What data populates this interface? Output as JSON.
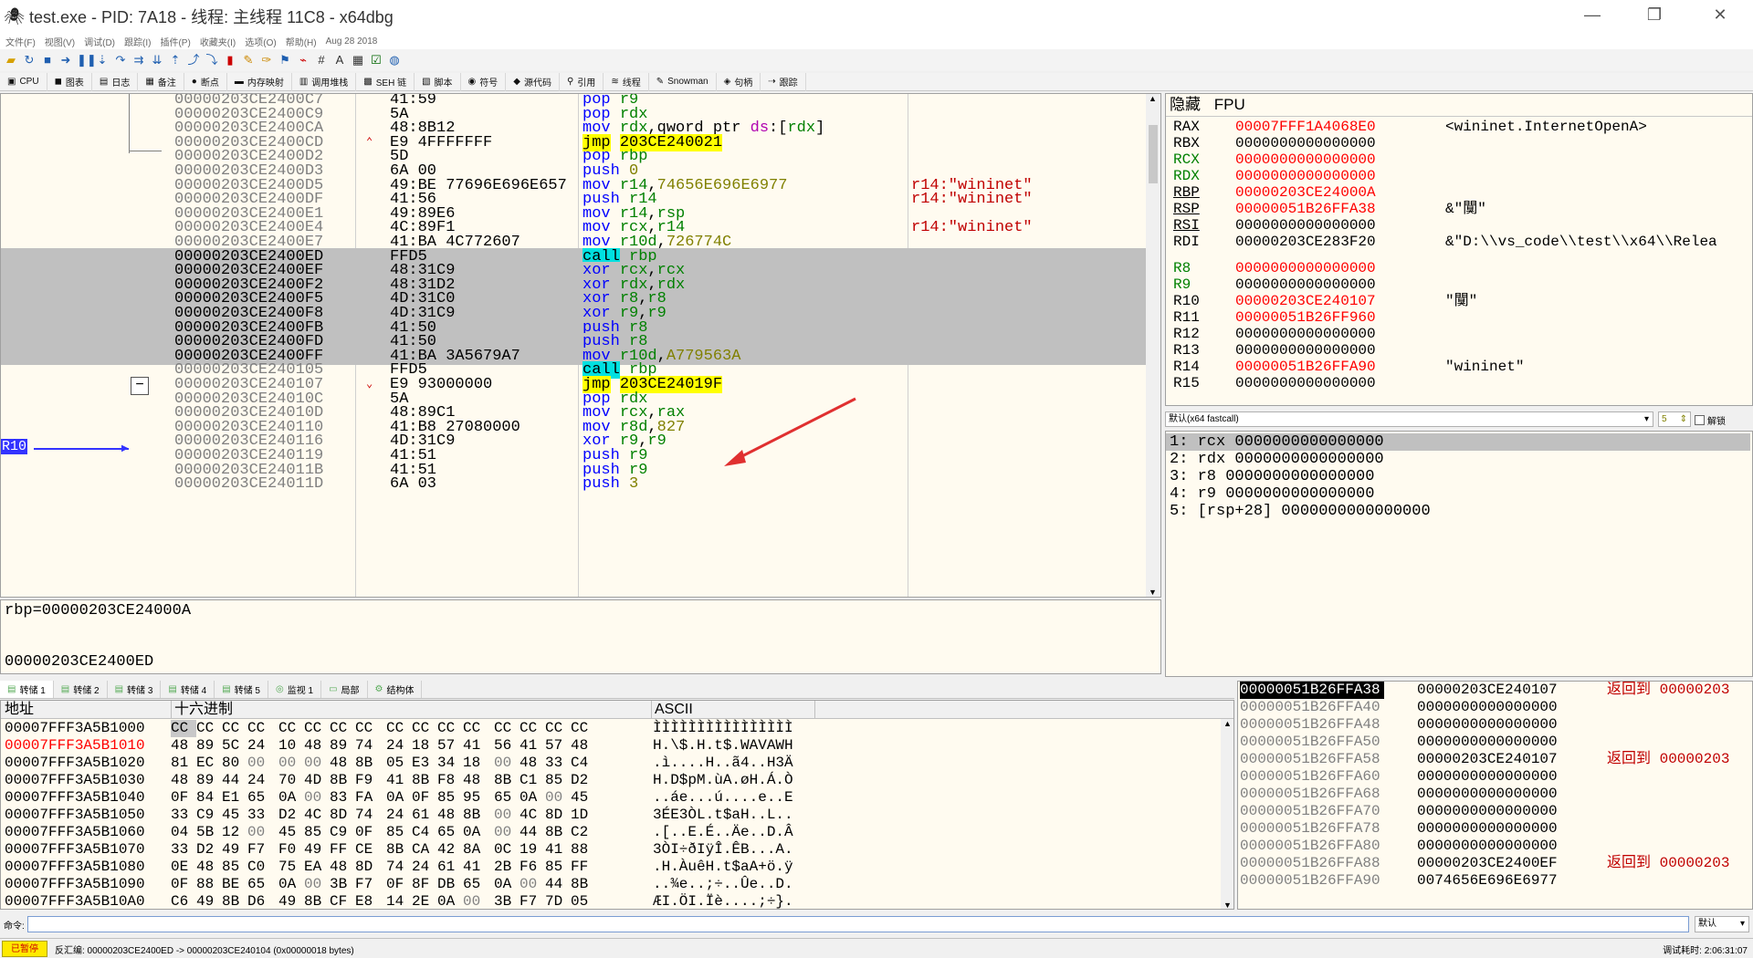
{
  "window": {
    "title": "test.exe - PID: 7A18 - 线程: 主线程 11C8 - x64dbg",
    "minimize": "—",
    "restore": "❐",
    "close": "✕"
  },
  "menu": [
    "文件(F)",
    "视图(V)",
    "调试(D)",
    "跟踪(I)",
    "插件(P)",
    "收藏夹(I)",
    "选项(O)",
    "帮助(H)",
    "Aug 28 2018"
  ],
  "tabs": [
    {
      "icon": "▣",
      "label": "CPU"
    },
    {
      "icon": "◼",
      "label": "图表"
    },
    {
      "icon": "▤",
      "label": "日志"
    },
    {
      "icon": "▦",
      "label": "备注"
    },
    {
      "icon": "●",
      "label": "断点"
    },
    {
      "icon": "▬",
      "label": "内存映射"
    },
    {
      "icon": "▥",
      "label": "调用堆栈"
    },
    {
      "icon": "▩",
      "label": "SEH 链"
    },
    {
      "icon": "▧",
      "label": "脚本"
    },
    {
      "icon": "◉",
      "label": "符号"
    },
    {
      "icon": "◆",
      "label": "源代码"
    },
    {
      "icon": "⚲",
      "label": "引用"
    },
    {
      "icon": "≋",
      "label": "线程"
    },
    {
      "icon": "✎",
      "label": "Snowman"
    },
    {
      "icon": "◈",
      "label": "句柄"
    },
    {
      "icon": "⇢",
      "label": "跟踪"
    }
  ],
  "disasm": [
    {
      "addr": "00000203CE2400C7",
      "bytes": "41:59",
      "mn": "pop",
      "ops": [
        [
          "r9",
          "reg"
        ]
      ],
      "comment": ""
    },
    {
      "addr": "00000203CE2400C9",
      "bytes": "5A",
      "mn": "pop",
      "ops": [
        [
          "rdx",
          "reg"
        ]
      ],
      "comment": ""
    },
    {
      "addr": "00000203CE2400CA",
      "bytes": "48:8B12",
      "mn": "mov",
      "ops": [
        [
          "rdx",
          "reg"
        ],
        [
          ",qword ptr ",
          "plain"
        ],
        [
          "ds",
          "ds"
        ],
        [
          ":[",
          "plain"
        ],
        [
          "rdx",
          "reg"
        ],
        [
          "]",
          "plain"
        ]
      ],
      "comment": ""
    },
    {
      "addr": "00000203CE2400CD",
      "bytes": "E9 4FFFFFFF",
      "mn": "jmp",
      "mnstyle": "hj",
      "ops": [
        [
          "203CE240021",
          "hj"
        ]
      ],
      "comment": "",
      "jarrow": "^"
    },
    {
      "addr": "00000203CE2400D2",
      "bytes": "5D",
      "mn": "pop",
      "ops": [
        [
          "rbp",
          "reg"
        ]
      ],
      "comment": ""
    },
    {
      "addr": "00000203CE2400D3",
      "bytes": "6A 00",
      "mn": "push",
      "ops": [
        [
          "0",
          "num"
        ]
      ],
      "comment": ""
    },
    {
      "addr": "00000203CE2400D5",
      "bytes": "49:BE 77696E696E657",
      "mn": "mov",
      "ops": [
        [
          "r14",
          "reg"
        ],
        [
          ",",
          "plain"
        ],
        [
          "74656E696E6977",
          "num"
        ]
      ],
      "comment": "r14:\"wininet\""
    },
    {
      "addr": "00000203CE2400DF",
      "bytes": "41:56",
      "mn": "push",
      "ops": [
        [
          "r14",
          "reg"
        ]
      ],
      "comment": "r14:\"wininet\""
    },
    {
      "addr": "00000203CE2400E1",
      "bytes": "49:89E6",
      "mn": "mov",
      "ops": [
        [
          "r14",
          "reg"
        ],
        [
          ",",
          "plain"
        ],
        [
          "rsp",
          "reg"
        ]
      ],
      "comment": ""
    },
    {
      "addr": "00000203CE2400E4",
      "bytes": "4C:89F1",
      "mn": "mov",
      "ops": [
        [
          "rcx",
          "reg"
        ],
        [
          ",",
          "plain"
        ],
        [
          "r14",
          "reg"
        ]
      ],
      "comment": "r14:\"wininet\""
    },
    {
      "addr": "00000203CE2400E7",
      "bytes": "41:BA 4C772607",
      "mn": "mov",
      "ops": [
        [
          "r10d",
          "reg"
        ],
        [
          ",",
          "plain"
        ],
        [
          "726774C",
          "num"
        ]
      ],
      "comment": ""
    },
    {
      "addr": "00000203CE2400ED",
      "bytes": "FFD5",
      "mn": "call",
      "mnstyle": "hc",
      "ops": [
        [
          "rbp",
          "reg"
        ]
      ],
      "comment": "",
      "sel": true
    },
    {
      "addr": "00000203CE2400EF",
      "bytes": "48:31C9",
      "mn": "xor",
      "ops": [
        [
          "rcx",
          "reg"
        ],
        [
          ",",
          "plain"
        ],
        [
          "rcx",
          "reg"
        ]
      ],
      "comment": "",
      "sel": true
    },
    {
      "addr": "00000203CE2400F2",
      "bytes": "48:31D2",
      "mn": "xor",
      "ops": [
        [
          "rdx",
          "reg"
        ],
        [
          ",",
          "plain"
        ],
        [
          "rdx",
          "reg"
        ]
      ],
      "comment": "",
      "sel": true
    },
    {
      "addr": "00000203CE2400F5",
      "bytes": "4D:31C0",
      "mn": "xor",
      "ops": [
        [
          "r8",
          "reg"
        ],
        [
          ",",
          "plain"
        ],
        [
          "r8",
          "reg"
        ]
      ],
      "comment": "",
      "sel": true
    },
    {
      "addr": "00000203CE2400F8",
      "bytes": "4D:31C9",
      "mn": "xor",
      "ops": [
        [
          "r9",
          "reg"
        ],
        [
          ",",
          "plain"
        ],
        [
          "r9",
          "reg"
        ]
      ],
      "comment": "",
      "sel": true
    },
    {
      "addr": "00000203CE2400FB",
      "bytes": "41:50",
      "mn": "push",
      "ops": [
        [
          "r8",
          "reg"
        ]
      ],
      "comment": "",
      "sel": true
    },
    {
      "addr": "00000203CE2400FD",
      "bytes": "41:50",
      "mn": "push",
      "ops": [
        [
          "r8",
          "reg"
        ]
      ],
      "comment": "",
      "sel": true
    },
    {
      "addr": "00000203CE2400FF",
      "bytes": "41:BA 3A5679A7",
      "mn": "mov",
      "ops": [
        [
          "r10d",
          "reg"
        ],
        [
          ",",
          "plain"
        ],
        [
          "A779563A",
          "num"
        ]
      ],
      "comment": "",
      "sel": true
    },
    {
      "addr": "00000203CE240105",
      "bytes": "FFD5",
      "mn": "call",
      "mnstyle": "hc",
      "ops": [
        [
          "rbp",
          "reg"
        ]
      ],
      "comment": ""
    },
    {
      "addr": "00000203CE240107",
      "bytes": "E9 93000000",
      "mn": "jmp",
      "mnstyle": "hj",
      "ops": [
        [
          "203CE24019F",
          "hj"
        ]
      ],
      "comment": "",
      "jarrow": "v"
    },
    {
      "addr": "00000203CE24010C",
      "bytes": "5A",
      "mn": "pop",
      "ops": [
        [
          "rdx",
          "reg"
        ]
      ],
      "comment": ""
    },
    {
      "addr": "00000203CE24010D",
      "bytes": "48:89C1",
      "mn": "mov",
      "ops": [
        [
          "rcx",
          "reg"
        ],
        [
          ",",
          "plain"
        ],
        [
          "rax",
          "reg"
        ]
      ],
      "comment": ""
    },
    {
      "addr": "00000203CE240110",
      "bytes": "41:B8 27080000",
      "mn": "mov",
      "ops": [
        [
          "r8d",
          "reg"
        ],
        [
          ",",
          "plain"
        ],
        [
          "827",
          "num"
        ]
      ],
      "comment": ""
    },
    {
      "addr": "00000203CE240116",
      "bytes": "4D:31C9",
      "mn": "xor",
      "ops": [
        [
          "r9",
          "reg"
        ],
        [
          ",",
          "plain"
        ],
        [
          "r9",
          "reg"
        ]
      ],
      "comment": ""
    },
    {
      "addr": "00000203CE240119",
      "bytes": "41:51",
      "mn": "push",
      "ops": [
        [
          "r9",
          "reg"
        ]
      ],
      "comment": ""
    },
    {
      "addr": "00000203CE24011B",
      "bytes": "41:51",
      "mn": "push",
      "ops": [
        [
          "r9",
          "reg"
        ]
      ],
      "comment": ""
    },
    {
      "addr": "00000203CE24011D",
      "bytes": "6A 03",
      "mn": "push",
      "ops": [
        [
          "3",
          "num"
        ]
      ],
      "comment": ""
    }
  ],
  "r10_tag": "R10",
  "info": {
    "line1": "rbp=00000203CE24000A",
    "line2": "00000203CE2400ED"
  },
  "regs_header": {
    "hide": "隐藏",
    "fpu": "FPU"
  },
  "registers": [
    {
      "name": "RAX",
      "value": "00007FFF1A4068E0",
      "changed": true,
      "comment": "<wininet.InternetOpenA>"
    },
    {
      "name": "RBX",
      "value": "0000000000000000",
      "changed": false,
      "comment": ""
    },
    {
      "name": "RCX",
      "value": "0000000000000000",
      "changed": true,
      "comment": "",
      "green": true
    },
    {
      "name": "RDX",
      "value": "0000000000000000",
      "changed": true,
      "comment": "",
      "green": true
    },
    {
      "name": "RBP",
      "value": "00000203CE24000A",
      "changed": true,
      "comment": "",
      "ul": true
    },
    {
      "name": "RSP",
      "value": "00000051B26FFA38",
      "changed": true,
      "comment": "&\"闃\"",
      "ul": true
    },
    {
      "name": "RSI",
      "value": "0000000000000000",
      "changed": false,
      "comment": "",
      "ul": true
    },
    {
      "name": "RDI",
      "value": "00000203CE283F20",
      "changed": false,
      "comment": "&\"D:\\\\vs_code\\\\test\\\\x64\\\\Relea"
    },
    {
      "name": "R8",
      "value": "0000000000000000",
      "changed": true,
      "comment": "",
      "green": true,
      "gap": true
    },
    {
      "name": "R9",
      "value": "0000000000000000",
      "changed": false,
      "comment": "",
      "green": true
    },
    {
      "name": "R10",
      "value": "00000203CE240107",
      "changed": true,
      "comment": "\"闃\""
    },
    {
      "name": "R11",
      "value": "00000051B26FF960",
      "changed": true,
      "comment": ""
    },
    {
      "name": "R12",
      "value": "0000000000000000",
      "changed": false,
      "comment": ""
    },
    {
      "name": "R13",
      "value": "0000000000000000",
      "changed": false,
      "comment": ""
    },
    {
      "name": "R14",
      "value": "00000051B26FFA90",
      "changed": true,
      "comment": "\"wininet\""
    },
    {
      "name": "R15",
      "value": "0000000000000000",
      "changed": false,
      "comment": ""
    }
  ],
  "callconv": {
    "select": "默认(x64 fastcall)",
    "count": "5",
    "unlock": "解锁"
  },
  "callargs": [
    "1: rcx 0000000000000000",
    "2: rdx 0000000000000000",
    "3: r8 0000000000000000",
    "4: r9 0000000000000000",
    "5: [rsp+28] 0000000000000000"
  ],
  "dump_tabs": [
    "转储 1",
    "转储 2",
    "转储 3",
    "转储 4",
    "转储 5",
    "监视 1",
    "局部",
    "结构体"
  ],
  "dump_header": {
    "addr": "地址",
    "hex": "十六进制",
    "ascii": "ASCII"
  },
  "dump": [
    {
      "addr": "00007FFF3A5B1000",
      "hex": [
        "CC",
        "CC",
        "CC",
        "CC",
        "CC",
        "CC",
        "CC",
        "CC",
        "CC",
        "CC",
        "CC",
        "CC",
        "CC",
        "CC",
        "CC",
        "CC"
      ],
      "ascii": "ÌÌÌÌÌÌÌÌÌÌÌÌÌÌÌÌ"
    },
    {
      "addr": "00007FFF3A5B1010",
      "hex": [
        "48",
        "89",
        "5C",
        "24",
        "10",
        "48",
        "89",
        "74",
        "24",
        "18",
        "57",
        "41",
        "56",
        "41",
        "57",
        "48"
      ],
      "ascii": "H.\\$.H.t$.WAVAWH",
      "red": true
    },
    {
      "addr": "00007FFF3A5B1020",
      "hex": [
        "81",
        "EC",
        "80",
        "00",
        "00",
        "00",
        "48",
        "8B",
        "05",
        "E3",
        "34",
        "18",
        "00",
        "48",
        "33",
        "C4"
      ],
      "ascii": ".ì....H..ã4..H3Ä"
    },
    {
      "addr": "00007FFF3A5B1030",
      "hex": [
        "48",
        "89",
        "44",
        "24",
        "70",
        "4D",
        "8B",
        "F9",
        "41",
        "8B",
        "F8",
        "48",
        "8B",
        "C1",
        "85",
        "D2"
      ],
      "ascii": "H.D$pM.ùA.øH.Á.Ò"
    },
    {
      "addr": "00007FFF3A5B1040",
      "hex": [
        "0F",
        "84",
        "E1",
        "65",
        "0A",
        "00",
        "83",
        "FA",
        "0A",
        "0F",
        "85",
        "95",
        "65",
        "0A",
        "00",
        "45"
      ],
      "ascii": "..áe...ú....e..E"
    },
    {
      "addr": "00007FFF3A5B1050",
      "hex": [
        "33",
        "C9",
        "45",
        "33",
        "D2",
        "4C",
        "8D",
        "74",
        "24",
        "61",
        "48",
        "8B",
        "00",
        "4C",
        "8D",
        "1D"
      ],
      "ascii": "3ÉE3ÒL.t$aH..L.."
    },
    {
      "addr": "00007FFF3A5B1060",
      "hex": [
        "04",
        "5B",
        "12",
        "00",
        "45",
        "85",
        "C9",
        "0F",
        "85",
        "C4",
        "65",
        "0A",
        "00",
        "44",
        "8B",
        "C2"
      ],
      "ascii": ".[..E.É..Äe..D.Â"
    },
    {
      "addr": "00007FFF3A5B1070",
      "hex": [
        "33",
        "D2",
        "49",
        "F7",
        "F0",
        "49",
        "FF",
        "CE",
        "8B",
        "CA",
        "42",
        "8A",
        "0C",
        "19",
        "41",
        "88"
      ],
      "ascii": "3ÒI÷ðIÿÎ.ÊB...A."
    },
    {
      "addr": "00007FFF3A5B1080",
      "hex": [
        "0E",
        "48",
        "85",
        "C0",
        "75",
        "EA",
        "48",
        "8D",
        "74",
        "24",
        "61",
        "41",
        "2B",
        "F6",
        "85",
        "FF"
      ],
      "ascii": ".H.ÀuêH.t$aA+ö.ÿ"
    },
    {
      "addr": "00007FFF3A5B1090",
      "hex": [
        "0F",
        "88",
        "BE",
        "65",
        "0A",
        "00",
        "3B",
        "F7",
        "0F",
        "8F",
        "DB",
        "65",
        "0A",
        "00",
        "44",
        "8B"
      ],
      "ascii": "..¾e..;÷..Ûe..D."
    },
    {
      "addr": "00007FFF3A5B10A0",
      "hex": [
        "C6",
        "49",
        "8B",
        "D6",
        "49",
        "8B",
        "CF",
        "E8",
        "14",
        "2E",
        "0A",
        "00",
        "3B",
        "F7",
        "7D",
        "05"
      ],
      "ascii": "ÆI.ÖI.Ïè....;÷}."
    }
  ],
  "stack": [
    {
      "addr": "00000051B26FFA38",
      "val": "00000203CE240107",
      "comment": "返回到 00000203",
      "sel": true
    },
    {
      "addr": "00000051B26FFA40",
      "val": "0000000000000000",
      "comment": ""
    },
    {
      "addr": "00000051B26FFA48",
      "val": "0000000000000000",
      "comment": ""
    },
    {
      "addr": "00000051B26FFA50",
      "val": "0000000000000000",
      "comment": ""
    },
    {
      "addr": "00000051B26FFA58",
      "val": "00000203CE240107",
      "comment": "返回到 00000203"
    },
    {
      "addr": "00000051B26FFA60",
      "val": "0000000000000000",
      "comment": ""
    },
    {
      "addr": "00000051B26FFA68",
      "val": "0000000000000000",
      "comment": ""
    },
    {
      "addr": "00000051B26FFA70",
      "val": "0000000000000000",
      "comment": ""
    },
    {
      "addr": "00000051B26FFA78",
      "val": "0000000000000000",
      "comment": ""
    },
    {
      "addr": "00000051B26FFA80",
      "val": "0000000000000000",
      "comment": ""
    },
    {
      "addr": "00000051B26FFA88",
      "val": "00000203CE2400EF",
      "comment": "返回到 00000203"
    },
    {
      "addr": "00000051B26FFA90",
      "val": "0074656E696E6977",
      "comment": ""
    }
  ],
  "cmd": {
    "label": "命令:",
    "default": "默认"
  },
  "status": {
    "paused": "已暂停",
    "message": "反汇编: 00000203CE2400ED -> 00000203CE240104 (0x00000018 bytes)",
    "time": "调试耗时: 2:06:31:07"
  },
  "colors": {
    "accent": "#3333ff",
    "changed": "#ff0000",
    "selection": "#c0c0c0"
  }
}
